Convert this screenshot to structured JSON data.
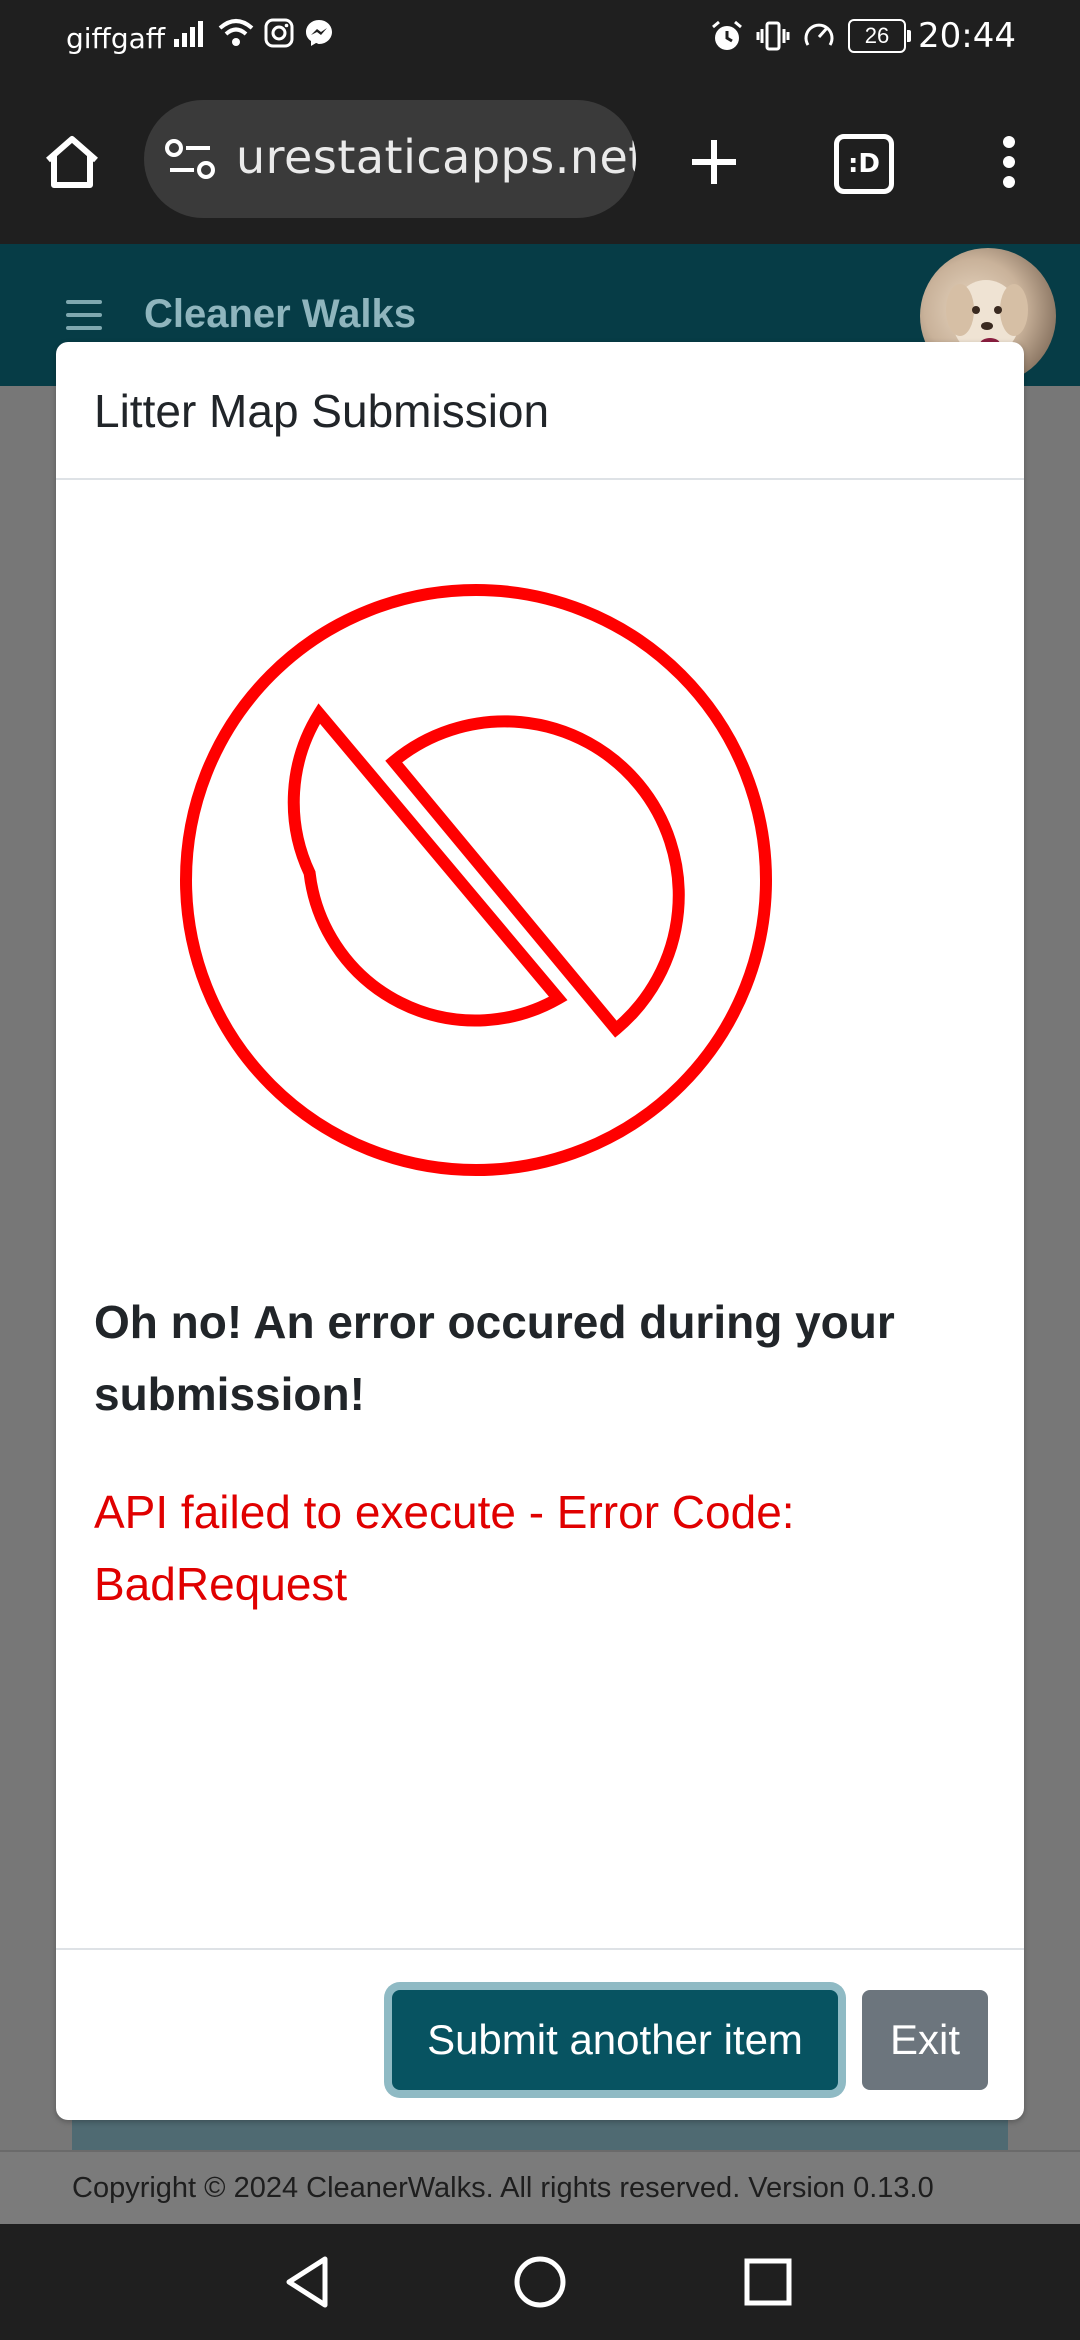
{
  "status_bar": {
    "carrier": "giffgaff",
    "battery": "26",
    "time": "20:44",
    "icons_left": [
      "signal-icon",
      "wifi-icon",
      "instagram-icon",
      "messenger-icon"
    ],
    "icons_right": [
      "alarm-icon",
      "vibrate-icon",
      "data-saver-icon",
      "battery-icon"
    ]
  },
  "browser": {
    "url": "urestaticapps.net",
    "tabs_label": ":D"
  },
  "app": {
    "title": "Cleaner Walks"
  },
  "modal": {
    "title": "Litter Map Submission",
    "heading": "Oh no! An error occured during your submission!",
    "detail": "API failed to execute - Error Code: BadRequest",
    "primary_button": "Submit another item",
    "secondary_button": "Exit"
  },
  "footer": {
    "text": "Copyright © 2024 CleanerWalks. All rights reserved. Version 0.13.0"
  },
  "colors": {
    "header_teal": "#063c46",
    "primary_button": "#075361",
    "error_red": "#e00000",
    "secondary_button": "#6c757d"
  }
}
